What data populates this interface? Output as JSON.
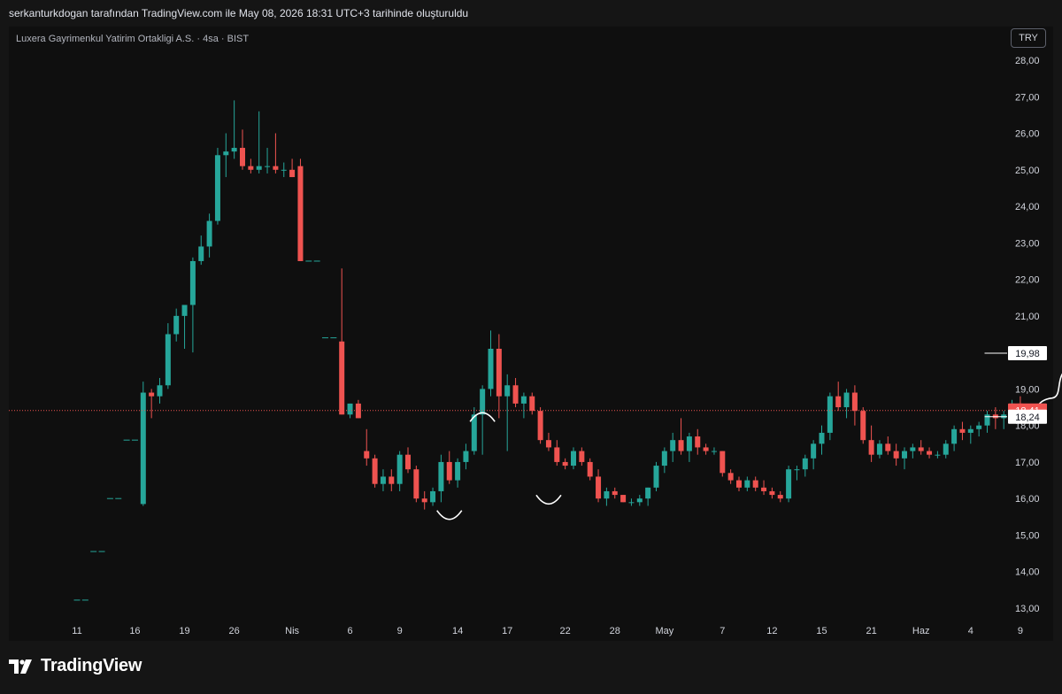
{
  "header": {
    "attribution": "serkanturkdogan tarafından TradingView.com ile May 08, 2026 18:31 UTC+3 tarihinde oluşturuldu"
  },
  "legend": {
    "title": "Luxera Gayrimenkul Yatirim Ortakligi A.S. · 4sa · BIST"
  },
  "currency_button": {
    "label": "TRY"
  },
  "footer": {
    "logo_text": "TradingView"
  },
  "colors": {
    "up": "#26a69a",
    "down": "#ef5350",
    "background": "#0f0f0f",
    "axis_text": "#d1d4dc",
    "drawing": "#ffffff",
    "price_line": "#ef5350"
  },
  "chart_data": {
    "type": "candlestick",
    "title": "Luxera Gayrimenkul Yatirim Ortakligi A.S. · 4sa · BIST",
    "ylim": [
      12.9,
      28.3
    ],
    "y_ticks": [
      "13,00",
      "14,00",
      "15,00",
      "16,00",
      "17,00",
      "18,00",
      "19,00",
      "20,00",
      "21,00",
      "22,00",
      "23,00",
      "24,00",
      "25,00",
      "26,00",
      "27,00",
      "28,00"
    ],
    "x_tick_labels": [
      {
        "label": "11",
        "bar": 0
      },
      {
        "label": "16",
        "bar": 7
      },
      {
        "label": "19",
        "bar": 13
      },
      {
        "label": "26",
        "bar": 19
      },
      {
        "label": "Nis",
        "bar": 26
      },
      {
        "label": "6",
        "bar": 33
      },
      {
        "label": "9",
        "bar": 39
      },
      {
        "label": "14",
        "bar": 46
      },
      {
        "label": "17",
        "bar": 52
      },
      {
        "label": "22",
        "bar": 59
      },
      {
        "label": "28",
        "bar": 65
      },
      {
        "label": "May",
        "bar": 71
      },
      {
        "label": "7",
        "bar": 78
      },
      {
        "label": "12",
        "bar": 84
      },
      {
        "label": "15",
        "bar": 90
      },
      {
        "label": "21",
        "bar": 96
      },
      {
        "label": "Haz",
        "bar": 102
      },
      {
        "label": "4",
        "bar": 108
      },
      {
        "label": "9",
        "bar": 114
      }
    ],
    "candles": [
      {
        "o": 13.22,
        "h": 13.22,
        "l": 13.22,
        "c": 13.22
      },
      {
        "o": 13.22,
        "h": 13.22,
        "l": 13.22,
        "c": 13.22
      },
      {
        "o": 14.55,
        "h": 14.55,
        "l": 14.55,
        "c": 14.55
      },
      {
        "o": 14.55,
        "h": 14.55,
        "l": 14.55,
        "c": 14.55
      },
      {
        "o": 16.0,
        "h": 16.0,
        "l": 16.0,
        "c": 16.0
      },
      {
        "o": 16.0,
        "h": 16.0,
        "l": 16.0,
        "c": 16.0
      },
      {
        "o": 17.6,
        "h": 17.6,
        "l": 17.6,
        "c": 17.6
      },
      {
        "o": 17.6,
        "h": 17.6,
        "l": 17.6,
        "c": 17.6
      },
      {
        "o": 15.85,
        "h": 19.2,
        "l": 15.8,
        "c": 18.9
      },
      {
        "o": 18.9,
        "h": 19.0,
        "l": 18.2,
        "c": 18.8
      },
      {
        "o": 18.8,
        "h": 19.3,
        "l": 18.6,
        "c": 19.1
      },
      {
        "o": 19.1,
        "h": 20.8,
        "l": 19.0,
        "c": 20.5
      },
      {
        "o": 20.5,
        "h": 21.2,
        "l": 20.3,
        "c": 21.0
      },
      {
        "o": 21.0,
        "h": 21.3,
        "l": 20.1,
        "c": 21.3
      },
      {
        "o": 21.3,
        "h": 22.6,
        "l": 20.0,
        "c": 22.5
      },
      {
        "o": 22.5,
        "h": 23.2,
        "l": 22.4,
        "c": 22.9
      },
      {
        "o": 22.9,
        "h": 23.8,
        "l": 22.6,
        "c": 23.6
      },
      {
        "o": 23.6,
        "h": 25.6,
        "l": 23.5,
        "c": 25.4
      },
      {
        "o": 25.4,
        "h": 26.0,
        "l": 24.8,
        "c": 25.5
      },
      {
        "o": 25.5,
        "h": 26.9,
        "l": 25.3,
        "c": 25.6
      },
      {
        "o": 25.6,
        "h": 26.1,
        "l": 25.0,
        "c": 25.1
      },
      {
        "o": 25.1,
        "h": 25.3,
        "l": 24.9,
        "c": 25.0
      },
      {
        "o": 25.0,
        "h": 26.6,
        "l": 24.9,
        "c": 25.1
      },
      {
        "o": 25.1,
        "h": 25.6,
        "l": 24.9,
        "c": 25.1
      },
      {
        "o": 25.1,
        "h": 26.0,
        "l": 24.9,
        "c": 25.0
      },
      {
        "o": 25.0,
        "h": 25.2,
        "l": 24.8,
        "c": 25.0
      },
      {
        "o": 25.0,
        "h": 25.3,
        "l": 24.8,
        "c": 24.8
      },
      {
        "o": 25.1,
        "h": 25.3,
        "l": 22.5,
        "c": 22.5
      },
      {
        "o": 22.5,
        "h": 22.5,
        "l": 22.5,
        "c": 22.5
      },
      {
        "o": 22.5,
        "h": 22.5,
        "l": 22.5,
        "c": 22.5
      },
      {
        "o": 20.4,
        "h": 20.4,
        "l": 20.4,
        "c": 20.4
      },
      {
        "o": 20.4,
        "h": 20.4,
        "l": 20.4,
        "c": 20.4
      },
      {
        "o": 20.3,
        "h": 22.3,
        "l": 18.3,
        "c": 18.3
      },
      {
        "o": 18.3,
        "h": 18.6,
        "l": 18.2,
        "c": 18.6
      },
      {
        "o": 18.6,
        "h": 18.7,
        "l": 18.2,
        "c": 18.2
      },
      {
        "o": 17.3,
        "h": 17.9,
        "l": 16.9,
        "c": 17.1
      },
      {
        "o": 17.1,
        "h": 17.2,
        "l": 16.3,
        "c": 16.4
      },
      {
        "o": 16.4,
        "h": 16.8,
        "l": 16.2,
        "c": 16.6
      },
      {
        "o": 16.6,
        "h": 16.8,
        "l": 16.2,
        "c": 16.4
      },
      {
        "o": 16.4,
        "h": 17.3,
        "l": 16.2,
        "c": 17.2
      },
      {
        "o": 17.2,
        "h": 17.4,
        "l": 16.7,
        "c": 16.8
      },
      {
        "o": 16.8,
        "h": 16.9,
        "l": 15.9,
        "c": 16.0
      },
      {
        "o": 16.0,
        "h": 16.2,
        "l": 15.7,
        "c": 15.9
      },
      {
        "o": 15.9,
        "h": 16.3,
        "l": 15.8,
        "c": 16.2
      },
      {
        "o": 16.2,
        "h": 17.2,
        "l": 15.9,
        "c": 17.0
      },
      {
        "o": 17.0,
        "h": 17.3,
        "l": 16.4,
        "c": 16.5
      },
      {
        "o": 16.5,
        "h": 17.1,
        "l": 16.3,
        "c": 17.0
      },
      {
        "o": 17.0,
        "h": 17.5,
        "l": 16.8,
        "c": 17.3
      },
      {
        "o": 17.3,
        "h": 18.5,
        "l": 17.2,
        "c": 18.3
      },
      {
        "o": 18.3,
        "h": 19.1,
        "l": 17.2,
        "c": 19.0
      },
      {
        "o": 19.0,
        "h": 20.6,
        "l": 18.8,
        "c": 20.1
      },
      {
        "o": 20.1,
        "h": 20.5,
        "l": 18.2,
        "c": 18.8
      },
      {
        "o": 18.8,
        "h": 19.4,
        "l": 17.3,
        "c": 19.1
      },
      {
        "o": 19.1,
        "h": 19.3,
        "l": 18.5,
        "c": 18.6
      },
      {
        "o": 18.6,
        "h": 18.9,
        "l": 18.2,
        "c": 18.8
      },
      {
        "o": 18.8,
        "h": 18.9,
        "l": 18.3,
        "c": 18.4
      },
      {
        "o": 18.4,
        "h": 18.5,
        "l": 17.5,
        "c": 17.6
      },
      {
        "o": 17.6,
        "h": 17.8,
        "l": 17.3,
        "c": 17.4
      },
      {
        "o": 17.4,
        "h": 17.6,
        "l": 16.9,
        "c": 17.0
      },
      {
        "o": 17.0,
        "h": 17.1,
        "l": 16.8,
        "c": 16.9
      },
      {
        "o": 16.9,
        "h": 17.4,
        "l": 16.8,
        "c": 17.3
      },
      {
        "o": 17.3,
        "h": 17.4,
        "l": 16.9,
        "c": 17.0
      },
      {
        "o": 17.0,
        "h": 17.1,
        "l": 16.5,
        "c": 16.6
      },
      {
        "o": 16.6,
        "h": 16.8,
        "l": 15.9,
        "c": 16.0
      },
      {
        "o": 16.0,
        "h": 16.3,
        "l": 15.8,
        "c": 16.2
      },
      {
        "o": 16.2,
        "h": 16.3,
        "l": 16.0,
        "c": 16.1
      },
      {
        "o": 16.1,
        "h": 16.1,
        "l": 15.9,
        "c": 15.9
      },
      {
        "o": 15.9,
        "h": 16.0,
        "l": 15.8,
        "c": 15.9
      },
      {
        "o": 15.9,
        "h": 16.1,
        "l": 15.8,
        "c": 16.0
      },
      {
        "o": 16.0,
        "h": 16.3,
        "l": 15.8,
        "c": 16.3
      },
      {
        "o": 16.3,
        "h": 17.0,
        "l": 16.2,
        "c": 16.9
      },
      {
        "o": 16.9,
        "h": 17.4,
        "l": 16.7,
        "c": 17.3
      },
      {
        "o": 17.3,
        "h": 17.8,
        "l": 17.0,
        "c": 17.6
      },
      {
        "o": 17.6,
        "h": 18.2,
        "l": 17.2,
        "c": 17.3
      },
      {
        "o": 17.3,
        "h": 17.8,
        "l": 17.0,
        "c": 17.7
      },
      {
        "o": 17.7,
        "h": 17.9,
        "l": 17.2,
        "c": 17.4
      },
      {
        "o": 17.4,
        "h": 17.5,
        "l": 17.2,
        "c": 17.3
      },
      {
        "o": 17.3,
        "h": 17.4,
        "l": 17.2,
        "c": 17.3
      },
      {
        "o": 17.3,
        "h": 17.3,
        "l": 16.6,
        "c": 16.7
      },
      {
        "o": 16.7,
        "h": 16.8,
        "l": 16.4,
        "c": 16.5
      },
      {
        "o": 16.5,
        "h": 16.6,
        "l": 16.2,
        "c": 16.3
      },
      {
        "o": 16.3,
        "h": 16.6,
        "l": 16.2,
        "c": 16.5
      },
      {
        "o": 16.5,
        "h": 16.6,
        "l": 16.2,
        "c": 16.3
      },
      {
        "o": 16.3,
        "h": 16.5,
        "l": 16.1,
        "c": 16.2
      },
      {
        "o": 16.2,
        "h": 16.3,
        "l": 16.0,
        "c": 16.1
      },
      {
        "o": 16.1,
        "h": 16.2,
        "l": 15.9,
        "c": 16.0
      },
      {
        "o": 16.0,
        "h": 16.9,
        "l": 15.9,
        "c": 16.8
      },
      {
        "o": 16.8,
        "h": 16.9,
        "l": 16.5,
        "c": 16.8
      },
      {
        "o": 16.8,
        "h": 17.2,
        "l": 16.6,
        "c": 17.1
      },
      {
        "o": 17.1,
        "h": 17.6,
        "l": 16.8,
        "c": 17.5
      },
      {
        "o": 17.5,
        "h": 18.0,
        "l": 17.2,
        "c": 17.8
      },
      {
        "o": 17.8,
        "h": 18.9,
        "l": 17.6,
        "c": 18.8
      },
      {
        "o": 18.8,
        "h": 19.2,
        "l": 18.4,
        "c": 18.5
      },
      {
        "o": 18.5,
        "h": 19.0,
        "l": 18.2,
        "c": 18.9
      },
      {
        "o": 18.9,
        "h": 19.1,
        "l": 18.0,
        "c": 18.4
      },
      {
        "o": 18.4,
        "h": 18.5,
        "l": 17.5,
        "c": 17.6
      },
      {
        "o": 17.6,
        "h": 18.0,
        "l": 17.0,
        "c": 17.2
      },
      {
        "o": 17.2,
        "h": 17.6,
        "l": 17.1,
        "c": 17.5
      },
      {
        "o": 17.5,
        "h": 17.7,
        "l": 17.2,
        "c": 17.3
      },
      {
        "o": 17.3,
        "h": 17.5,
        "l": 16.9,
        "c": 17.1
      },
      {
        "o": 17.1,
        "h": 17.4,
        "l": 16.8,
        "c": 17.3
      },
      {
        "o": 17.3,
        "h": 17.5,
        "l": 17.1,
        "c": 17.4
      },
      {
        "o": 17.4,
        "h": 17.6,
        "l": 17.2,
        "c": 17.3
      },
      {
        "o": 17.3,
        "h": 17.4,
        "l": 17.1,
        "c": 17.2
      },
      {
        "o": 17.2,
        "h": 17.3,
        "l": 17.1,
        "c": 17.2
      },
      {
        "o": 17.2,
        "h": 17.6,
        "l": 17.1,
        "c": 17.5
      },
      {
        "o": 17.5,
        "h": 18.0,
        "l": 17.3,
        "c": 17.9
      },
      {
        "o": 17.9,
        "h": 18.1,
        "l": 17.6,
        "c": 17.8
      },
      {
        "o": 17.8,
        "h": 18.0,
        "l": 17.5,
        "c": 17.9
      },
      {
        "o": 17.9,
        "h": 18.1,
        "l": 17.7,
        "c": 18.0
      },
      {
        "o": 18.0,
        "h": 18.4,
        "l": 17.8,
        "c": 18.3
      },
      {
        "o": 18.3,
        "h": 18.5,
        "l": 17.9,
        "c": 18.2
      },
      {
        "o": 18.2,
        "h": 18.4,
        "l": 17.9,
        "c": 18.3
      },
      {
        "o": 18.3,
        "h": 18.7,
        "l": 18.2,
        "c": 18.6
      },
      {
        "o": 18.6,
        "h": 18.8,
        "l": 18.4,
        "c": 18.41
      }
    ],
    "current_price": {
      "value": 18.41,
      "label": "18,41"
    },
    "levels": [
      {
        "value": 19.98,
        "label": "19,98"
      },
      {
        "value": 18.24,
        "label": "18,24"
      }
    ],
    "annotations": [
      "smile-arc",
      "frown-arc",
      "smile-arc",
      "projected-path"
    ],
    "grid": false
  }
}
